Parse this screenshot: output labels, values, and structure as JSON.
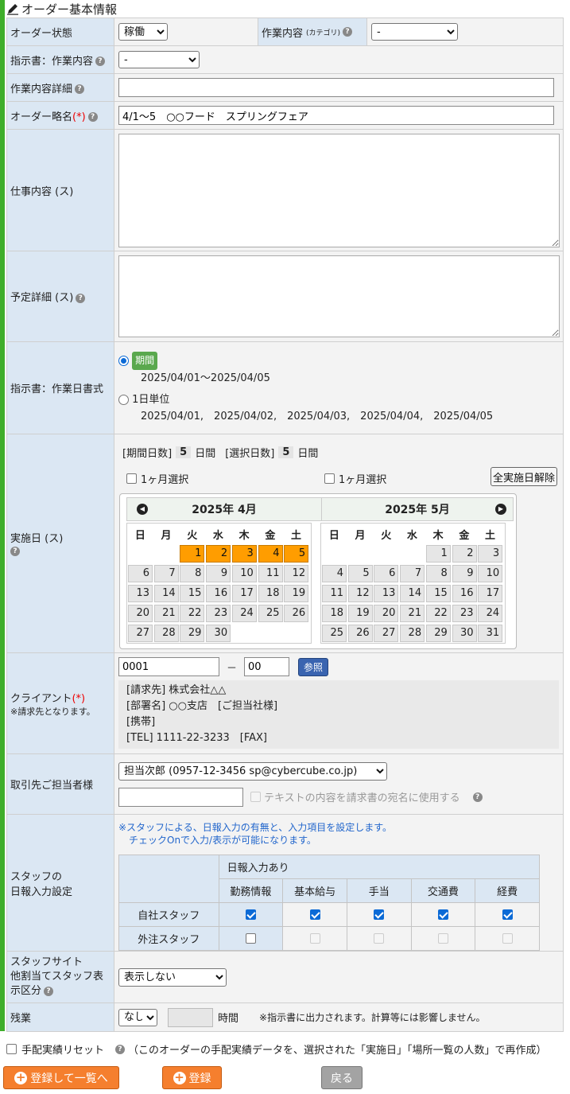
{
  "section_title": "オーダー基本情報",
  "rows": {
    "order_status": {
      "label": "オーダー状態",
      "value": "稼働"
    },
    "work_category": {
      "label": "作業内容",
      "label_sub": "(カテゴリ)",
      "value": "-"
    },
    "instruction_work": {
      "label": "指示書：作業内容",
      "value": "-"
    },
    "work_detail": {
      "label": "作業内容詳細",
      "value": ""
    },
    "order_short_name": {
      "label": "オーダー略名",
      "req": "(*)",
      "value": "4/1～5　○○フード　スプリングフェア"
    },
    "job_content": {
      "label": "仕事内容 (ス)",
      "value": ""
    },
    "schedule_detail": {
      "label": "予定詳細 (ス)",
      "value": ""
    },
    "instruction_daily": {
      "label": "指示書：作業日書式",
      "option_period_label": "期間",
      "option_period_dates": "2025/04/01～2025/04/05",
      "option_daily_label": "1日単位",
      "option_daily_dates": "2025/04/01,　2025/04/02,　2025/04/03,　2025/04/04,　2025/04/05"
    },
    "execution_date": {
      "label": "実施日 (ス)",
      "period_days_label": "[期間日数]",
      "period_days": "5",
      "day_unit": "日間",
      "selected_days_label": "[選択日数]",
      "selected_days": "5",
      "month_select_left": "1ヶ月選択",
      "month_select_right": "1ヶ月選択",
      "clear_all": "全実施日解除"
    },
    "client": {
      "label": "クライアント",
      "req": "(*)",
      "note": "※請求先となります。",
      "code1": "0001",
      "dash": "－",
      "code2": "00",
      "ref_button": "参照",
      "info": [
        "[請求先] 株式会社△△",
        "[部署名] ○○支店　[ご担当社様]",
        "[携帯]",
        "[TEL] 1111-22-3233　[FAX]"
      ]
    },
    "contact": {
      "label": "取引先ご担当者様",
      "value": "担当次郎  (0957-12-3456 sp@cybercube.co.jp)",
      "text_value": "",
      "use_text_label": "テキストの内容を請求書の宛名に使用する"
    },
    "staff_report": {
      "label_line1": "スタッフの",
      "label_line2": "日報入力設定",
      "note1": "※スタッフによる、日報入力の有無と、入力項目を設定します。",
      "note2": "チェックOnで入力/表示が可能になります。",
      "group_header": "日報入力あり",
      "columns": [
        "勤務情報",
        "基本給与",
        "手当",
        "交通費",
        "経費"
      ],
      "staff_rows": [
        {
          "name": "自社スタッフ",
          "main": true,
          "cols": [
            true,
            true,
            true,
            true,
            true
          ]
        },
        {
          "name": "外注スタッフ",
          "main": false,
          "cols": [
            false,
            false,
            false,
            false,
            false
          ]
        }
      ]
    },
    "staff_site": {
      "label_line1": "スタッフサイト",
      "label_line2": "他割当てスタッフ表",
      "label_line3": "示区分",
      "value": "表示しない"
    },
    "overtime": {
      "label": "残業",
      "value": "なし",
      "hours": "",
      "unit": "時間",
      "note": "※指示書に出力されます。計算等には影響しません。"
    }
  },
  "calendar": {
    "weekdays": [
      "日",
      "月",
      "火",
      "水",
      "木",
      "金",
      "土"
    ],
    "months": [
      {
        "title": "2025年 4月",
        "offset": 2,
        "days": 30,
        "selected": [
          1,
          2,
          3,
          4,
          5
        ]
      },
      {
        "title": "2025年 5月",
        "offset": 4,
        "days": 31,
        "selected": []
      }
    ]
  },
  "footer": {
    "reset_label": "手配実績リセット",
    "reset_note": "（このオーダーの手配実績データを、選択された「実施日」「場所一覧の人数」で再作成）",
    "register_and_list": "登録して一覧へ",
    "register": "登録",
    "back": "戻る"
  },
  "colors": {
    "accent_green": "#3fae2a",
    "header_bg": "#dbe7f3",
    "selected_day": "#ff9d00",
    "button_orange": "#f57f2e"
  }
}
